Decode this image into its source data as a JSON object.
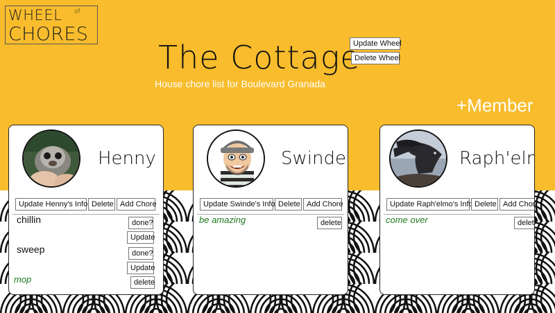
{
  "logo": {
    "line1": "WHEEL",
    "of": "of",
    "line2": "CHORES"
  },
  "wheel": {
    "title": "The Cottage",
    "description": "House chore list for Boulevard Granada",
    "update_label": "Update Wheel",
    "delete_label": "Delete Wheel"
  },
  "add_member_label": "+Member",
  "colors": {
    "background": "#F8BC2C",
    "goal": "#1E7A1E"
  },
  "members": [
    {
      "name": "Henny",
      "avatar": "monkey-photo",
      "update_label": "Update Henny's Info",
      "delete_label": "Delete",
      "add_chore_label": "Add Chore",
      "chores": [
        {
          "name": "chillin",
          "done_label": "done?",
          "update_label": "Update"
        },
        {
          "name": "sweep",
          "done_label": "done?",
          "update_label": "Update"
        }
      ],
      "goal": {
        "name": "mop",
        "delete_label": "delete"
      }
    },
    {
      "name": "Swinde",
      "avatar": "cartoon-burglar",
      "update_label": "Update Swinde's Info",
      "delete_label": "Delete",
      "add_chore_label": "Add Chore",
      "goal": {
        "name": "be amazing",
        "delete_label": "delete"
      }
    },
    {
      "name": "Raph'elmo",
      "avatar": "horse-photo",
      "update_label": "Update Raph'elmo's Info",
      "delete_label": "Delete",
      "add_chore_label": "Add Chore",
      "goal": {
        "name": "come over",
        "delete_label": "delete"
      }
    }
  ]
}
